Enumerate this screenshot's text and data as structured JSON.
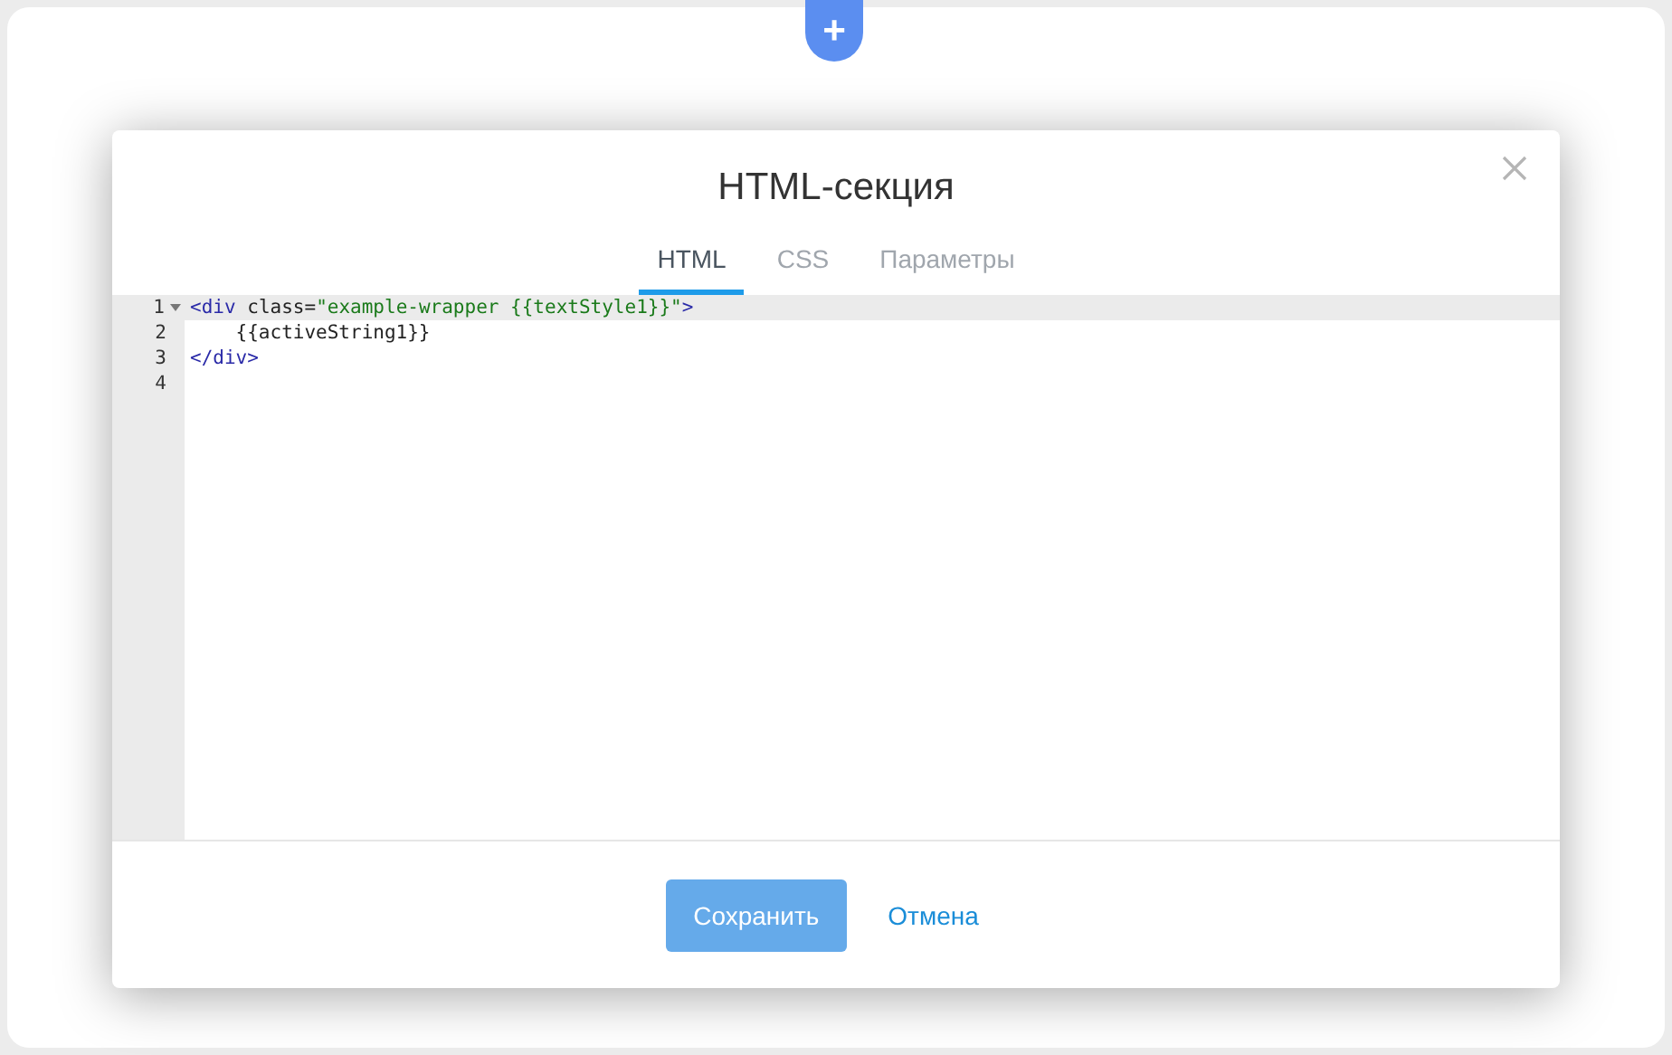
{
  "add_button": {
    "label": "+"
  },
  "dialog": {
    "title": "HTML-секция",
    "tabs": [
      {
        "label": "HTML",
        "selected": true
      },
      {
        "label": "CSS",
        "selected": false
      },
      {
        "label": "Параметры",
        "selected": false
      }
    ],
    "editor": {
      "lines": [
        {
          "number": "1",
          "active": true,
          "foldable": true,
          "tokens": [
            {
              "kind": "tag",
              "text": "<div"
            },
            {
              "kind": "attr",
              "text": " class="
            },
            {
              "kind": "string",
              "text": "\"example-wrapper {{textStyle1}}\""
            },
            {
              "kind": "tag",
              "text": ">"
            }
          ]
        },
        {
          "number": "2",
          "active": false,
          "foldable": false,
          "tokens": [
            {
              "kind": "text",
              "text": "    {{activeString1}}"
            }
          ]
        },
        {
          "number": "3",
          "active": false,
          "foldable": false,
          "tokens": [
            {
              "kind": "tag",
              "text": "</div>"
            }
          ]
        },
        {
          "number": "4",
          "active": false,
          "foldable": false
        }
      ]
    },
    "buttons": [
      {
        "label": "Сохранить",
        "kind": "primary"
      },
      {
        "label": "Отмена",
        "kind": "link"
      }
    ]
  }
}
